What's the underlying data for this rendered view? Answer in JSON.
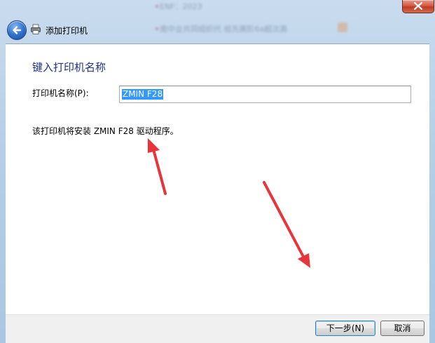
{
  "window": {
    "title": "添加打印机"
  },
  "background_blur": {
    "line1": "ENF：2023",
    "line2": "南中业共同组织代 组先赛阶6a超次高"
  },
  "main": {
    "heading": "键入打印机名称",
    "name_label": "打印机名称(P):",
    "name_value": "ZMIN F28",
    "info": "该打印机将安装 ZMIN F28 驱动程序。"
  },
  "footer": {
    "next_label": "下一步(N)",
    "cancel_label": "取消"
  },
  "colors": {
    "heading": "#1e3287",
    "selection": "#3399ff",
    "annotation_arrow": "#e8343a"
  },
  "icons": {
    "back": "back-arrow-icon",
    "printer": "printer-icon",
    "close": "close-icon"
  }
}
